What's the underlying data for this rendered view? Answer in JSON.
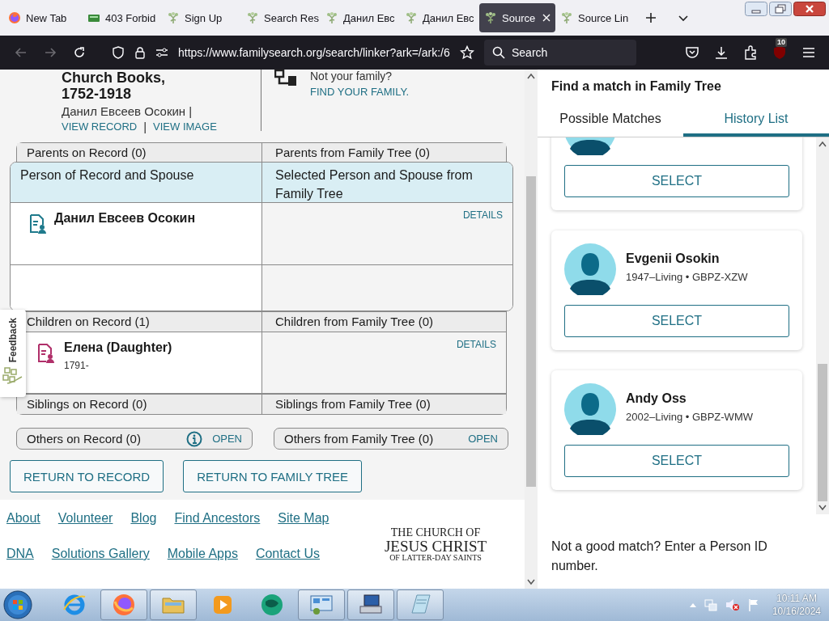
{
  "browser": {
    "tabs": [
      {
        "kind": "firefox",
        "label": "New Tab",
        "selected": false
      },
      {
        "kind": "card",
        "label": "403 Forbid",
        "selected": false
      },
      {
        "kind": "tree",
        "label": "Sign Up",
        "selected": false
      },
      {
        "kind": "tree",
        "label": "Search Res",
        "selected": false
      },
      {
        "kind": "tree",
        "label": "Данил Евс",
        "selected": false
      },
      {
        "kind": "tree",
        "label": "Данил Евс",
        "selected": false
      },
      {
        "kind": "tree",
        "label": "Source",
        "selected": true
      },
      {
        "kind": "tree",
        "label": "Source Lin",
        "selected": false
      }
    ],
    "url": "https://www.familysearch.org/search/linker?ark=/ark:/6",
    "search": {
      "placeholder": "Search"
    },
    "extension_badge": "10"
  },
  "record_header": {
    "title_lines": [
      "Church Books,",
      "1752-1918"
    ],
    "name": "Данил Евсеев Осокин |",
    "links": [
      "VIEW RECORD",
      "VIEW IMAGE"
    ],
    "link_separator": "|",
    "not_your_family": "Not your family?",
    "find_link": "FIND YOUR FAMILY."
  },
  "sections": [
    {
      "kind": "group",
      "left": "Parents on Record (0)",
      "right": "Parents from Family Tree (0)"
    },
    {
      "kind": "primary",
      "left": "Person of Record and Spouse",
      "right": "Selected Person and Spouse from Family Tree",
      "rows": [
        {
          "kind": "person",
          "name": "Данил Евсеев Осокин",
          "color": "#1f7a8c",
          "details": "DETAILS"
        },
        {
          "kind": "blank"
        }
      ]
    },
    {
      "kind": "group",
      "left": "Children on Record (1)",
      "right": "Children from Family Tree (0)",
      "rows": [
        {
          "kind": "person",
          "name": "Елена (Daughter)",
          "dates": "1791-",
          "color": "#b0306a",
          "details": "DETAILS"
        }
      ]
    },
    {
      "kind": "group",
      "left": "Siblings on Record (0)",
      "right": "Siblings from Family Tree (0)"
    }
  ],
  "others": [
    {
      "label": "Others on Record (0)",
      "info": true,
      "action": "OPEN"
    },
    {
      "label": "Others from Family Tree (0)",
      "info": false,
      "action": "OPEN"
    }
  ],
  "buttons": [
    "RETURN TO RECORD",
    "RETURN TO FAMILY TREE"
  ],
  "footer": {
    "link_rows": [
      [
        "About",
        "Volunteer",
        "Blog",
        "Find Ancestors",
        "Site Map"
      ],
      [
        "DNA",
        "Solutions Gallery",
        "Mobile Apps",
        "Contact Us"
      ]
    ],
    "logo_lines": [
      "THE CHURCH OF",
      "JESUS CHRIST",
      "OF LATTER-DAY SAINTS"
    ]
  },
  "feedback": {
    "label": "Feedback"
  },
  "match_panel": {
    "title": "Find a match in Family Tree",
    "tabs": [
      {
        "label": "Possible Matches",
        "selected": false
      },
      {
        "label": "History List",
        "selected": true
      }
    ],
    "results": [
      {
        "select": "SELECT"
      },
      {
        "name": "Evgenii Osokin",
        "details": "1947–Living • GBPZ-XZW",
        "select": "SELECT"
      },
      {
        "name": "Andy Oss",
        "details": "2002–Living • GBPZ-WMW",
        "select": "SELECT"
      }
    ],
    "footer_text": "Not a good match? Enter a Person ID number."
  },
  "taskbar": {
    "apps": [
      {
        "kind": "ie",
        "running": false
      },
      {
        "kind": "firefox",
        "running": true
      },
      {
        "kind": "folder",
        "running": true
      },
      {
        "kind": "media",
        "running": false
      },
      {
        "kind": "globe",
        "running": false
      },
      {
        "kind": "panel",
        "running": true
      },
      {
        "kind": "network",
        "running": true
      },
      {
        "kind": "notepad",
        "running": true
      }
    ],
    "time": "10:11 AM",
    "date": "10/16/2024"
  }
}
